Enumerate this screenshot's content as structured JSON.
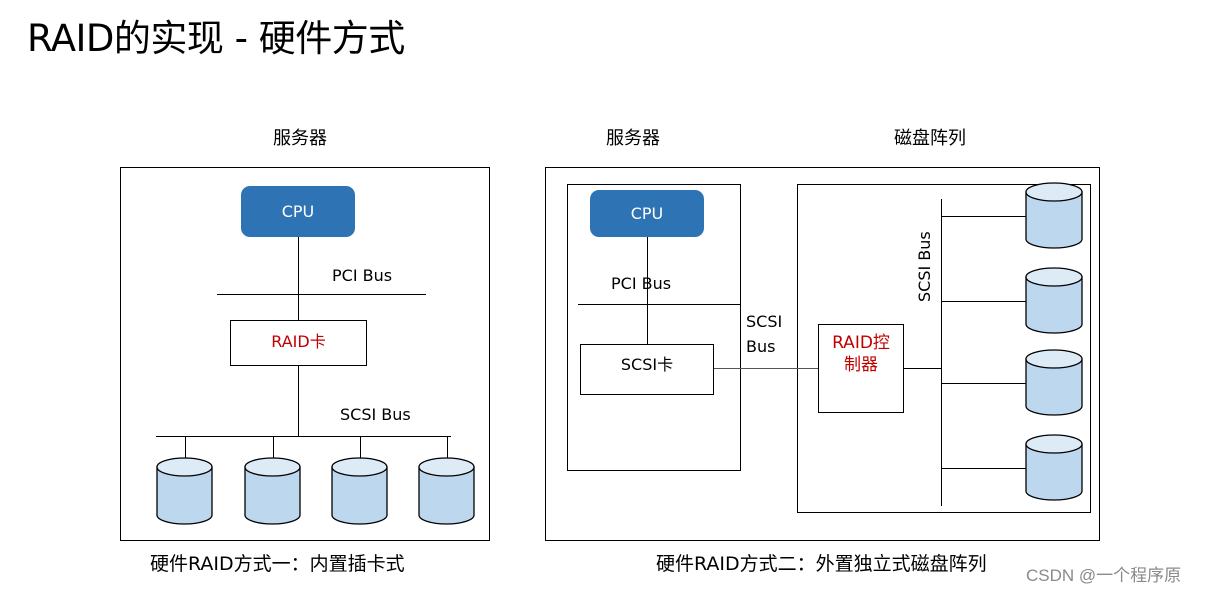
{
  "slide": {
    "title": "RAID的实现 - 硬件方式"
  },
  "colors": {
    "cpu_fill": "#2e74b5",
    "accent_red": "#c00000",
    "disk_body": "#bdd7ee",
    "disk_top": "#ddebf7",
    "watermark": "#8a8a8a"
  },
  "diagram_internal": {
    "server_label": "服务器",
    "cpu_label": "CPU",
    "pci_bus_label": "PCI Bus",
    "raid_card_label": "RAID卡",
    "scsi_bus_label": "SCSI Bus",
    "disk_count": 4,
    "disks": [
      {
        "name": "disk-1"
      },
      {
        "name": "disk-2"
      },
      {
        "name": "disk-3"
      },
      {
        "name": "disk-4"
      }
    ],
    "caption": "硬件RAID方式一：内置插卡式"
  },
  "diagram_external": {
    "server_label": "服务器",
    "array_label": "磁盘阵列",
    "cpu_label": "CPU",
    "pci_bus_label": "PCI Bus",
    "scsi_card_label": "SCSI卡",
    "scsi_bus_label_line1": "SCSI",
    "scsi_bus_label_line2": "Bus",
    "raid_controller_line1": "RAID控",
    "raid_controller_line2": "制器",
    "array_scsi_bus_label": "SCSI Bus",
    "disk_count": 4,
    "disks": [
      {
        "name": "array-disk-1"
      },
      {
        "name": "array-disk-2"
      },
      {
        "name": "array-disk-3"
      },
      {
        "name": "array-disk-4"
      }
    ],
    "caption": "硬件RAID方式二：外置独立式磁盘阵列"
  },
  "watermark": "CSDN @一个程序原"
}
